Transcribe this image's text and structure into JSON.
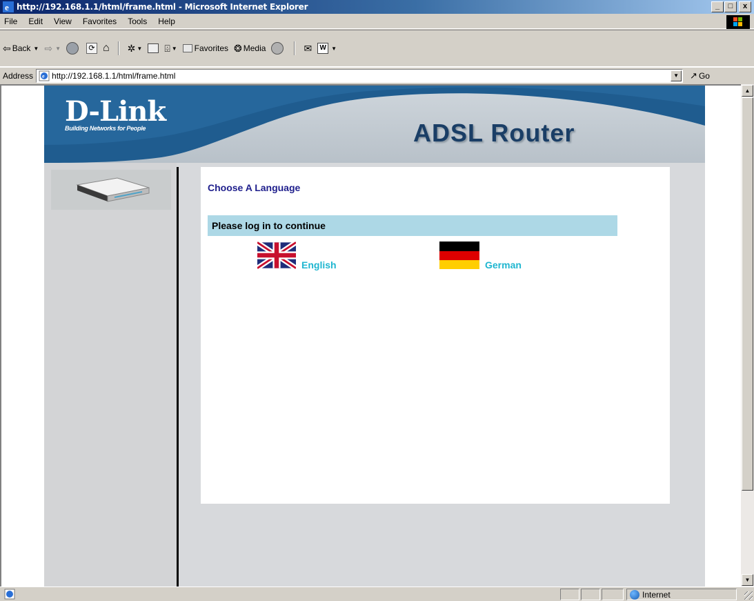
{
  "window": {
    "title": "http://192.168.1.1/html/frame.html - Microsoft Internet Explorer",
    "controls": [
      "_",
      "□",
      "x"
    ]
  },
  "menu": [
    {
      "label": "File"
    },
    {
      "label": "Edit"
    },
    {
      "label": "View"
    },
    {
      "label": "Favorites"
    },
    {
      "label": "Tools"
    },
    {
      "label": "Help"
    }
  ],
  "toolbar": {
    "back_label": "Back",
    "favorites_label": "Favorites",
    "media_label": "Media"
  },
  "address": {
    "label": "Address",
    "url": "http://192.168.1.1/html/frame.html",
    "go_label": "Go"
  },
  "page": {
    "brand_logo": "D-Link",
    "brand_tagline": "Building Networks for People",
    "product_title": "ADSL Router",
    "heading": "Choose A Language",
    "login_prompt": "Please log in to continue",
    "languages": [
      {
        "label": "English",
        "icon": "uk-flag-icon"
      },
      {
        "label": "German",
        "icon": "germany-flag-icon"
      }
    ]
  },
  "status": {
    "zone": "Internet"
  },
  "colors": {
    "header_blue": "#1f5c8f",
    "heading_navy": "#1e1e8c",
    "login_bar": "#add8e6",
    "language_link": "#1fb6d0"
  }
}
